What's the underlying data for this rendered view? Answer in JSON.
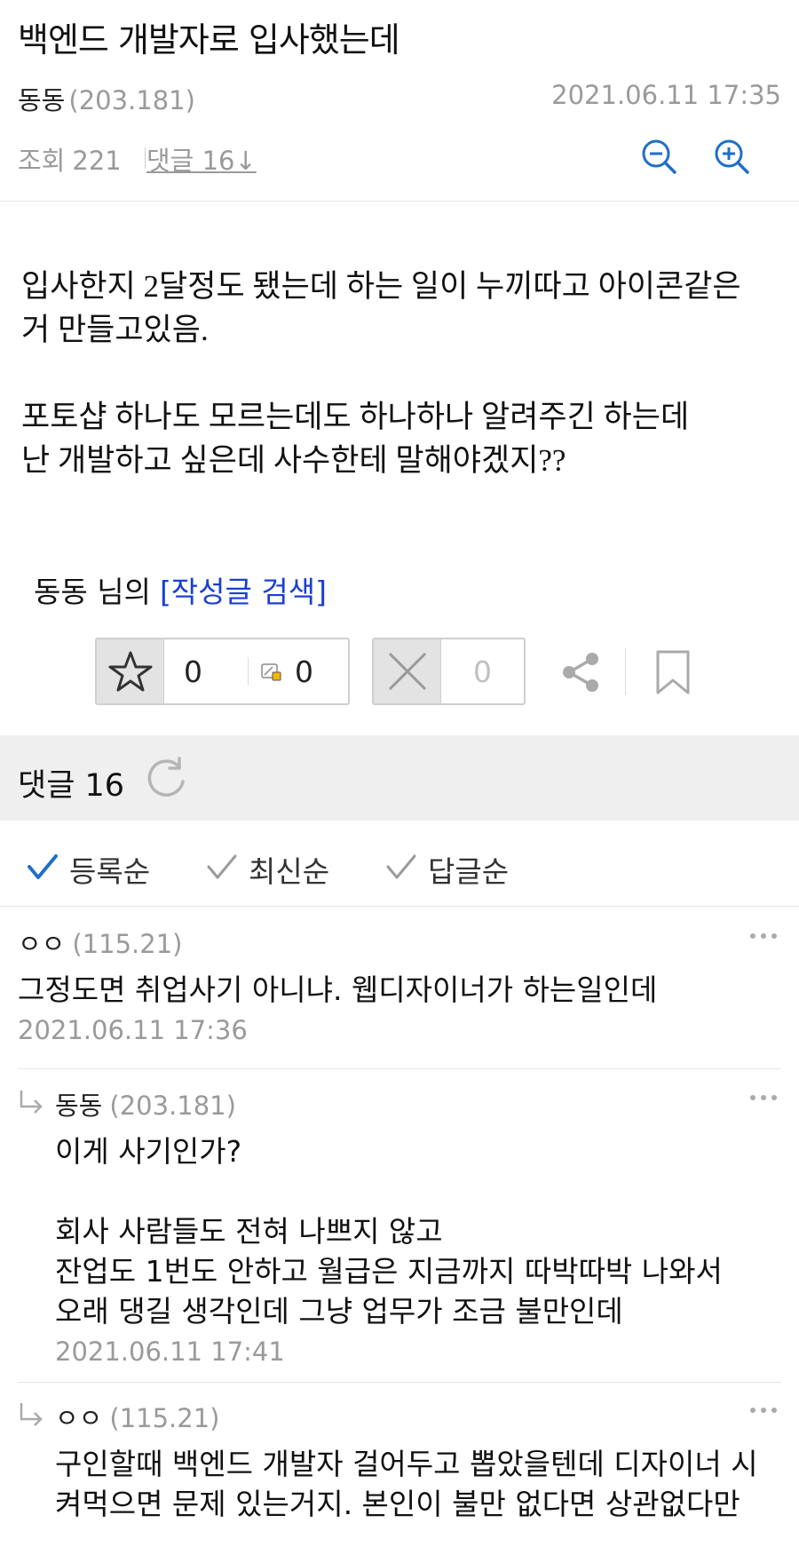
{
  "post": {
    "title": "백엔드 개발자로 입사했는데",
    "author": "동동",
    "author_ip": "(203.181)",
    "date": "2021.06.11 17:35",
    "views_label": "조회",
    "views": "221",
    "comment_link": "댓글 16↓",
    "body": "입사한지 2달정도 됐는데 하는 일이 누끼따고 아이콘같은\n거 만들고있음.\n\n포토샵 하나도 모르는데도 하나하나 알려주긴 하는데\n난 개발하고 싶은데 사수한테 말해야겠지??",
    "author_search_prefix": "동동 님의",
    "author_search_link": "[작성글 검색]"
  },
  "actions": {
    "recommend_count": "0",
    "fix_recommend_count": "0",
    "not_recommend_count": "0"
  },
  "comments_header": {
    "title": "댓글 16"
  },
  "sort": {
    "options": [
      "등록순",
      "최신순",
      "답글순"
    ],
    "selected_color": "#1f6fc7",
    "unselected_color": "#9a9a9a"
  },
  "comments": [
    {
      "author": "ㅇㅇ",
      "ip": "(115.21)",
      "text": "그정도면 취업사기 아니냐. 웹디자이너가 하는일인데",
      "date": "2021.06.11 17:36",
      "reply": false
    },
    {
      "author": "동동",
      "ip": "(203.181)",
      "text": "이게 사기인가?\n\n회사 사람들도 전혀 나쁘지 않고\n잔업도 1번도 안하고 월급은 지금까지 따박따박 나와서\n오래 댕길 생각인데 그냥 업무가 조금 불만인데",
      "date": "2021.06.11 17:41",
      "reply": true
    },
    {
      "author": "ㅇㅇ",
      "ip": "(115.21)",
      "text": "구인할때 백엔드 개발자 걸어두고 뽑았을텐데 디자이너 시\n켜먹으면 문제 있는거지. 본인이 불만 없다면 상관없다만",
      "date": "",
      "reply": true
    }
  ],
  "colors": {
    "link_blue": "#1a3fd0",
    "icon_blue": "#1f6fc7",
    "meta_gray": "#9a9a9a"
  },
  "icons": {
    "zoom_out": "zoom-out-icon",
    "zoom_in": "zoom-in-icon",
    "star": "star-icon",
    "x": "x-icon",
    "share": "share-icon",
    "bookmark": "bookmark-icon",
    "refresh": "refresh-icon",
    "check": "check-icon",
    "reply": "reply-arrow-icon",
    "more": "more-dots-icon"
  }
}
